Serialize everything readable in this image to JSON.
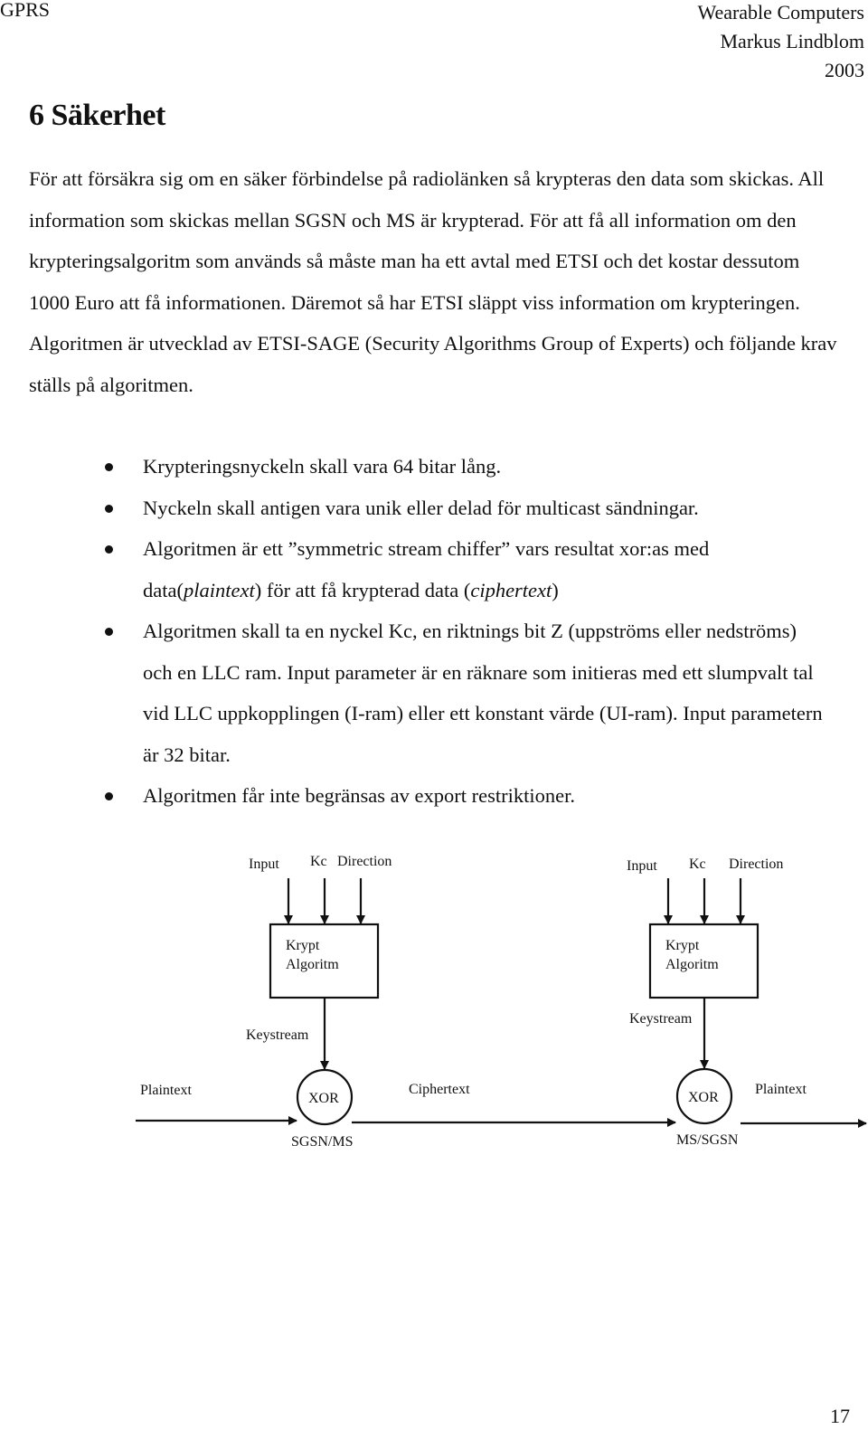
{
  "header": {
    "left": "GPRS",
    "right_lines": [
      "Wearable Computers",
      "Markus Lindblom",
      "2003"
    ]
  },
  "section": {
    "title": "6 Säkerhet"
  },
  "intro_paragraph": "För att försäkra sig om en säker förbindelse på radiolänken så krypteras den data som skickas. All information som skickas mellan SGSN och MS är krypterad. För att få all information om den krypteringsalgoritm som används så måste man ha ett avtal med ETSI och det kostar dessutom 1000 Euro att få informationen. Däremot så har ETSI släppt viss information om krypteringen. Algoritmen är utvecklad av ETSI-SAGE (Security Algorithms Group of Experts) och följande krav ställs på algoritmen.",
  "requirements": [
    {
      "text": "Krypteringsnyckeln skall vara 64 bitar lång."
    },
    {
      "text": "Nyckeln skall antigen vara unik eller delad för multicast sändningar."
    },
    {
      "pre": "Algoritmen är ett ”symmetric stream chiffer” vars resultat xor:as med data(",
      "italic1": "plaintext",
      "mid": ") för att få krypterad data (",
      "italic2": "ciphertext",
      "post": ")"
    },
    {
      "text": "Algoritmen skall ta en nyckel Kc, en riktnings bit Z (uppströms eller nedströms) och en LLC ram. Input parameter är en räknare som initieras med ett slumpvalt tal vid LLC uppkopplingen (I-ram) eller ett konstant värde (UI-ram). Input parametern är 32 bitar."
    },
    {
      "text": "Algoritmen får inte begränsas av export restriktioner."
    }
  ],
  "diagram": {
    "sender": {
      "inputs": [
        "Input",
        "Kc",
        "Direction"
      ],
      "box_lines": [
        "Krypt",
        "Algoritm"
      ],
      "keystream_label": "Keystream",
      "xor_label": "XOR",
      "in_label": "Plaintext",
      "node_label": "SGSN/MS"
    },
    "channel_label": "Ciphertext",
    "receiver": {
      "inputs": [
        "Input",
        "Kc",
        "Direction"
      ],
      "box_lines": [
        "Krypt",
        "Algoritm"
      ],
      "keystream_label": "Keystream",
      "xor_label": "XOR",
      "out_label": "Plaintext",
      "node_label": "MS/SGSN"
    }
  },
  "footer": {
    "page_number": "17"
  }
}
